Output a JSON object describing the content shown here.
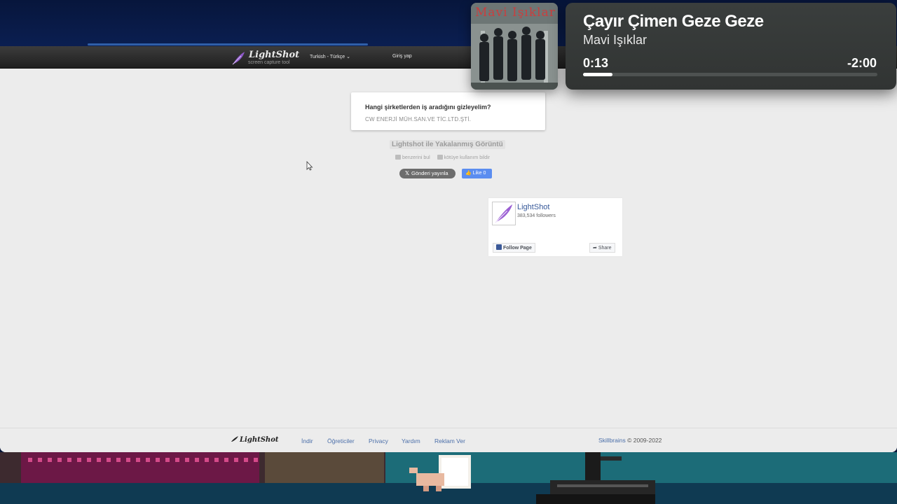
{
  "browser": {
    "header": {
      "logo_text": "LightShot",
      "logo_tagline": "screen capture tool",
      "language_label": "Turkish - Türkçe",
      "login_label": "Giriş yap"
    },
    "ad": {
      "question": "Hangi şirketlerden iş aradığını gizleyelim?",
      "answer": "CW ENERJİ MÜH.SAN.VE TİC.LTD.ŞTİ."
    },
    "screenshot": {
      "title": "Lightshot ile Yakalanmış Görüntü",
      "find_similar": "benzerini bul",
      "report_abuse": "kötüye kullanım bildir"
    },
    "social": {
      "tweet_label": "Gönderi yayınla",
      "like_label": "Like 0"
    },
    "fb_page": {
      "name": "LightShot",
      "followers": "383,534 followers",
      "follow_label": "Follow Page",
      "share_label": "Share"
    },
    "footer": {
      "logo_text": "LightShot",
      "links": [
        "İndir",
        "Öğreticiler",
        "Privacy",
        "Yardım",
        "Reklam Ver"
      ],
      "copyright_brand": "Skillbrains",
      "copyright_rest": "© 2009-2022"
    }
  },
  "now_playing": {
    "album_art_text": "Mavi Işıklar",
    "song": "Çayır Çimen Geze Geze",
    "artist": "Mavi Işıklar",
    "elapsed": "0:13",
    "remaining": "-2:00",
    "progress": 0.1
  },
  "colors": {
    "link": "#4a6ea9",
    "fb_blue": "#3b5998",
    "like_blue": "#5b8df0",
    "game_teal": "#1c6c78"
  }
}
